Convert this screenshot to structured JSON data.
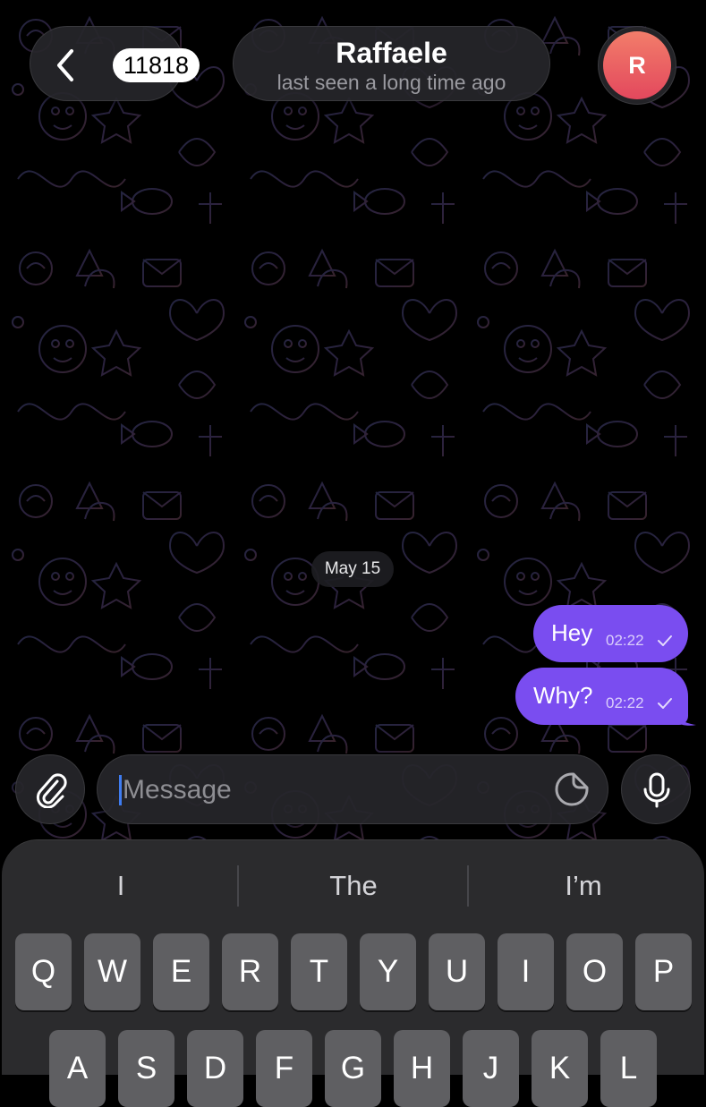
{
  "header": {
    "back_count": "11818",
    "contact_name": "Raffaele",
    "contact_status": "last seen a long time ago",
    "avatar_initial": "R",
    "avatar_colors": [
      "#f27d6a",
      "#e3485d"
    ]
  },
  "chat": {
    "date_label": "May 15",
    "bubble_color": "#7a4df0",
    "messages": [
      {
        "text": "Hey",
        "time": "02:22",
        "status": "sent-check-icon"
      },
      {
        "text": "Why?",
        "time": "02:22",
        "status": "sent-check-icon"
      }
    ]
  },
  "composer": {
    "placeholder": "Message",
    "attach_icon": "paperclip-icon",
    "sticker_icon": "sticker-icon",
    "mic_icon": "microphone-icon",
    "caret_color": "#3f7cf0"
  },
  "keyboard": {
    "suggestions": [
      "I",
      "The",
      "I’m"
    ],
    "row1": [
      "Q",
      "W",
      "E",
      "R",
      "T",
      "Y",
      "U",
      "I",
      "O",
      "P"
    ],
    "row2": [
      "A",
      "S",
      "D",
      "F",
      "G",
      "H",
      "J",
      "K",
      "L"
    ]
  }
}
